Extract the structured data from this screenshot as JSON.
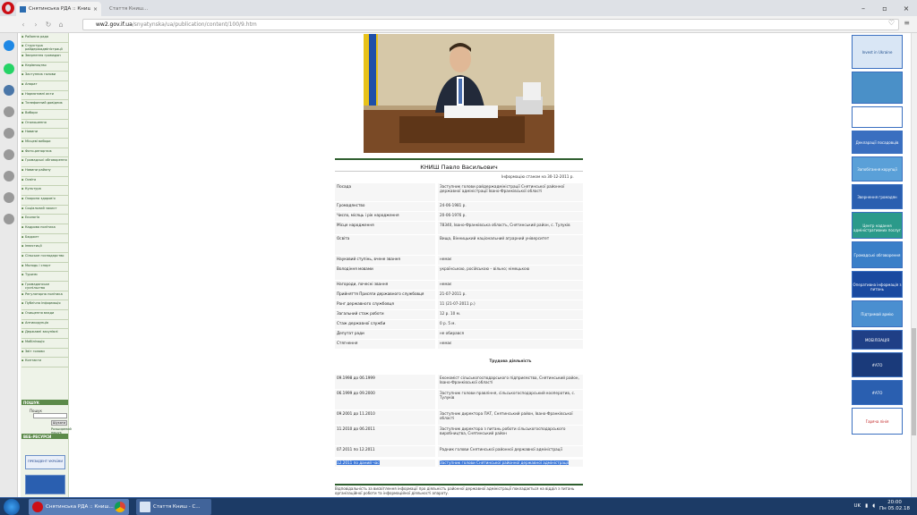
{
  "browser": {
    "tab_title": "Снятинська РДА :: Книш П...",
    "tab2_title": "Стаття Книш...",
    "url_host": "ww2.gov.if.ua",
    "url_path": "/snyatynska/ua/publication/content/100/9.htm"
  },
  "left_nav": {
    "items": [
      "Районна рада",
      "Структура райдержадміністрації",
      "Звернення громадян",
      "Керівництво",
      "Заступник голови",
      "Апарат",
      "Нормативні акти",
      "Телефонний довідник",
      "Вибори",
      "Оголошення",
      "Новини",
      "Місцеві вибори",
      "Фото-репортаж",
      "Громадські обговорення",
      "Новини району",
      "Освіта",
      "Культура",
      "Охорона здоров'я",
      "Соціальний захист",
      "Екологія",
      "Кадрова політика",
      "Бюджет",
      "Інвестиції",
      "Сільське господарство",
      "Молодь і спорт",
      "Туризм",
      "Громадянське суспільство",
      "Регуляторна політика",
      "Публічна інформація",
      "Очищення влади",
      "Антикорупція",
      "Державні закупівлі",
      "Мобілізація",
      "Звіт голови",
      "Контакти"
    ],
    "search_head": "ПОШУК",
    "search_label": "Пошук",
    "search_btn": "Шукати",
    "adv_search": "Розширений пошук",
    "banner_head": "ВЕБ-РЕСУРСИ",
    "banner_text": "ПРЕЗИДЕНТ УКРАЇНИ"
  },
  "person": {
    "name": "КНИШ Павло Васильович",
    "info_date": "Інформацію станом на 30-12-2011 р.",
    "rows": [
      {
        "k": "Посада",
        "v": "Заступник голови райдержадміністрації Снятинської районної державної адміністрації Івано-Франківської області"
      },
      {
        "k": "Громадянство",
        "v": "24-06-1981 р."
      },
      {
        "k": "Число, місяць і рік народження",
        "v": "20-06-1976 р."
      },
      {
        "k": "Місце народження",
        "v": "78340, Івано-Франківська область, Снятинський район, с. Тулуків"
      },
      {
        "k": "Освіта",
        "v": "Вища, Вінницький національний аграрний університет"
      },
      {
        "k": "Науковий ступінь, вчене звання",
        "v": "немає"
      },
      {
        "k": "Володіння мовами",
        "v": "українською, російською – вільно; німецькою"
      },
      {
        "k": "Нагороди, почесні звання",
        "v": "немає"
      },
      {
        "k": "Прийняття Присяги державного службовця",
        "v": "21-07-2011 р."
      },
      {
        "k": "Ранг державного службовця",
        "v": "11 (21-07-2011 р.)"
      },
      {
        "k": "Загальний стаж роботи",
        "v": "12 р. 10 м."
      },
      {
        "k": "Стаж державної служби",
        "v": "0 р. 5 м."
      },
      {
        "k": "Депутат ради",
        "v": "не обирався"
      },
      {
        "k": "Стягнення",
        "v": "немає"
      }
    ],
    "work_title": "Трудова діяльність",
    "work": [
      {
        "k": "09.1998 до 06.1999",
        "v": "Економіст сільськогосподарського підприємства, Снятинський район, Івано-Франківської області"
      },
      {
        "k": "06.1999 до 09.2000",
        "v": "Заступник голови правління, сільськогосподарський кооператив, с. Тулуків"
      },
      {
        "k": "09.2001 до 11.2010",
        "v": "Заступник директора ПАТ, Снятинський район, Івано-Франківської області"
      },
      {
        "k": "11.2010 до 06.2011",
        "v": "Заступник директора з питань роботи сільськогосподарського виробництва, Снятинський район"
      },
      {
        "k": "07.2011 по 12.2011",
        "v": "Радник голови Снятинської районної державної адміністрації"
      }
    ],
    "last_row": {
      "k": "12.2011 по даний час",
      "v": "Заступник голови Снятинської районної державної адміністрації"
    },
    "footer": "Відповідальність за висвітлення інформації про діяльність районної державної адміністрації покладається на відділ з питань організаційної роботи та інформаційної діяльності апарату."
  },
  "right_banners": [
    {
      "text": "Invest in Ukraine",
      "bg": "#d9e6f5",
      "fg": "#1a4a8a"
    },
    {
      "text": "",
      "bg": "#4a90c8",
      "fg": "#ffffff"
    },
    {
      "text": "",
      "bg": "#ffffff",
      "fg": "#1a4a8a"
    },
    {
      "text": "Декларації посадовців",
      "bg": "#3a6fc0",
      "fg": "#ffffff"
    },
    {
      "text": "Запобігання корупції",
      "bg": "#5aa0d8",
      "fg": "#ffffff"
    },
    {
      "text": "Звернення громадян",
      "bg": "#2a5fb0",
      "fg": "#ffffff"
    },
    {
      "text": "Центр надання адміністративних послуг",
      "bg": "#2b9a8a",
      "fg": "#ffffff"
    },
    {
      "text": "Громадські обговорення",
      "bg": "#3a7fc8",
      "fg": "#ffffff"
    },
    {
      "text": "Оперативна інформація з питань",
      "bg": "#1a4aa0",
      "fg": "#ffffff"
    },
    {
      "text": "Підтримай армію",
      "bg": "#4a8fd0",
      "fg": "#ffffff"
    },
    {
      "text": "МОБІЛІЗАЦІЯ",
      "bg": "#1f3f86",
      "fg": "#ffffff"
    },
    {
      "text": "#АТО",
      "bg": "#1a3a7a",
      "fg": "#ffffff"
    },
    {
      "text": "#АТО",
      "bg": "#2a5fb0",
      "fg": "#ffffff"
    },
    {
      "text": "Гаряча лінія",
      "bg": "#ffffff",
      "fg": "#c02020"
    }
  ],
  "taskbar": {
    "btn1": "Снятинська РДА :: Книш...",
    "btn2": "Стаття Книш - С...",
    "lang": "UK",
    "time": "20:00",
    "date": "Пн 05.02.18"
  }
}
